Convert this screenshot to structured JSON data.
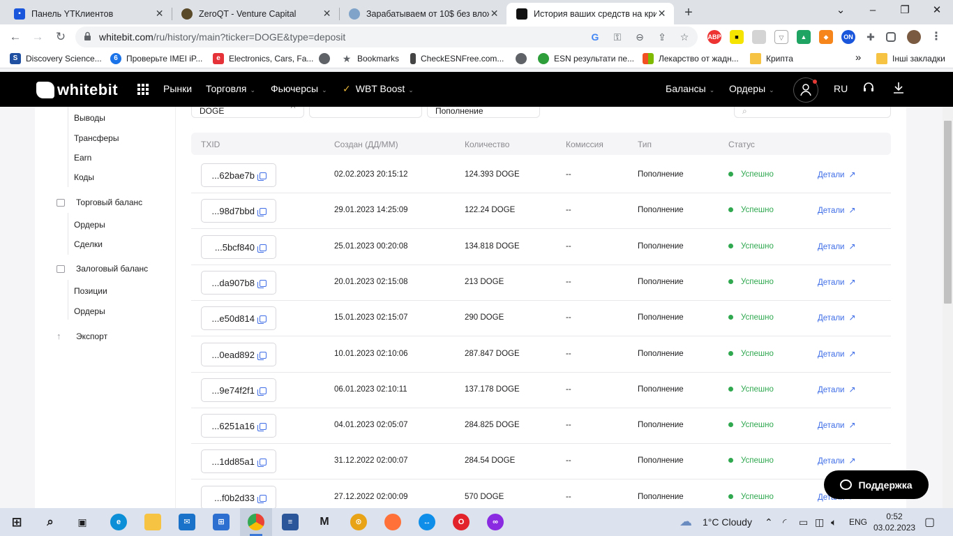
{
  "browser": {
    "tabs": [
      {
        "title": "Панель YTКлиентов",
        "fav_color": "#1a56db"
      },
      {
        "title": "ZeroQT - Venture Capital",
        "fav_color": "#5a4a2a"
      },
      {
        "title": "Зарабатываем от 10$ без влож",
        "fav_color": "#7fa3c9"
      },
      {
        "title": "История ваших средств на кри",
        "fav_color": "#111111"
      }
    ],
    "close_glyph": "✕",
    "newtab_glyph": "+",
    "url_host": "whitebit.com",
    "url_path": "/ru/history/main?ticker=DOGE&type=deposit",
    "bookmarks": [
      {
        "label": "Discovery Science...",
        "color": "#1f4fa0"
      },
      {
        "label": "Проверьте IMEI iP...",
        "color": "#1a73e8"
      },
      {
        "label": "Electronics, Cars, Fa...",
        "color": "#e53238"
      },
      {
        "label": "Bookmarks",
        "color": "#5f6368"
      },
      {
        "label": "CheckESNFree.com...",
        "color": "#444"
      },
      {
        "label": "ESN результати пе...",
        "color": "#2e9e3b"
      },
      {
        "label": "Лекарство от жадн...",
        "color": "#f25022"
      },
      {
        "label": "Крипта",
        "color": "#f6c342"
      },
      {
        "label": "Інші закладки",
        "color": "#f6c342"
      }
    ],
    "more_bookmarks": "»"
  },
  "header": {
    "logo_text": "whitebit",
    "nav": [
      {
        "label": "Рынки",
        "caret": ""
      },
      {
        "label": "Торговля",
        "caret": "⌄"
      },
      {
        "label": "Фьючерсы",
        "caret": "⌄"
      },
      {
        "label": "WBT Boost",
        "caret": "⌄"
      }
    ],
    "right_nav": [
      {
        "label": "Балансы",
        "caret": "⌄"
      },
      {
        "label": "Ордеры",
        "caret": "⌄"
      }
    ],
    "language": "RU"
  },
  "sidebar": {
    "items_top": [
      "Выводы",
      "Трансферы",
      "Earn",
      "Коды"
    ],
    "trade_section": "Торговый баланс",
    "trade_items": [
      "Ордеры",
      "Сделки"
    ],
    "margin_section": "Залоговый баланс",
    "margin_items": [
      "Позиции",
      "Ордеры"
    ],
    "export": "Экспорт"
  },
  "filters": {
    "ticker": "DOGE",
    "type": "Пополнение"
  },
  "table": {
    "headers": [
      "TXID",
      "Создан (ДД/ММ)",
      "Количество",
      "Комиссия",
      "Тип",
      "Статус"
    ],
    "details_label": "Детали",
    "rows": [
      {
        "txid": "...62bae7b",
        "created": "02.02.2023 20:15:12",
        "amount": "124.393 DOGE",
        "fee": "--",
        "type": "Пополнение",
        "status": "Успешно"
      },
      {
        "txid": "...98d7bbd",
        "created": "29.01.2023 14:25:09",
        "amount": "122.24 DOGE",
        "fee": "--",
        "type": "Пополнение",
        "status": "Успешно"
      },
      {
        "txid": "...5bcf840",
        "created": "25.01.2023 00:20:08",
        "amount": "134.818 DOGE",
        "fee": "--",
        "type": "Пополнение",
        "status": "Успешно"
      },
      {
        "txid": "...da907b8",
        "created": "20.01.2023 02:15:08",
        "amount": "213 DOGE",
        "fee": "--",
        "type": "Пополнение",
        "status": "Успешно"
      },
      {
        "txid": "...e50d814",
        "created": "15.01.2023 02:15:07",
        "amount": "290 DOGE",
        "fee": "--",
        "type": "Пополнение",
        "status": "Успешно"
      },
      {
        "txid": "...0ead892",
        "created": "10.01.2023 02:10:06",
        "amount": "287.847 DOGE",
        "fee": "--",
        "type": "Пополнение",
        "status": "Успешно"
      },
      {
        "txid": "...9e74f2f1",
        "created": "06.01.2023 02:10:11",
        "amount": "137.178 DOGE",
        "fee": "--",
        "type": "Пополнение",
        "status": "Успешно"
      },
      {
        "txid": "...6251a16",
        "created": "04.01.2023 02:05:07",
        "amount": "284.825 DOGE",
        "fee": "--",
        "type": "Пополнение",
        "status": "Успешно"
      },
      {
        "txid": "...1dd85a1",
        "created": "31.12.2022 02:00:07",
        "amount": "284.54 DOGE",
        "fee": "--",
        "type": "Пополнение",
        "status": "Успешно"
      },
      {
        "txid": "...f0b2d33",
        "created": "27.12.2022 02:00:09",
        "amount": "570 DOGE",
        "fee": "--",
        "type": "Пополнение",
        "status": "Успешно"
      }
    ]
  },
  "support_label": "Поддержка",
  "taskbar": {
    "weather": "1°C  Cloudy",
    "lang": "ENG",
    "time": "0:52",
    "date": "03.02.2023"
  },
  "colors": {
    "accent_blue": "#3d6ce6",
    "success_green": "#2fa84f",
    "header_bg": "#000000"
  }
}
